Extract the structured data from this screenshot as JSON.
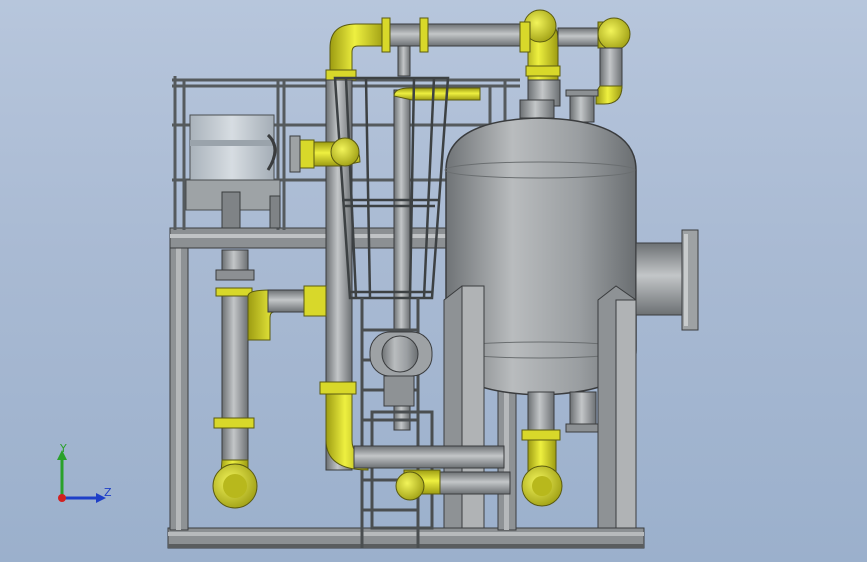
{
  "viewport": {
    "background_top": "#b7c6dc",
    "background_bottom": "#9bb0cc"
  },
  "model": {
    "steel_color": "#8f9396",
    "flange_color": "#d6d62a",
    "highlight_color": "#c9cbcc"
  },
  "triad": {
    "y_label": "Y",
    "z_label": "Z",
    "y_color": "#2aa12a",
    "z_color": "#1e3fc8",
    "origin_color": "#d22020"
  }
}
